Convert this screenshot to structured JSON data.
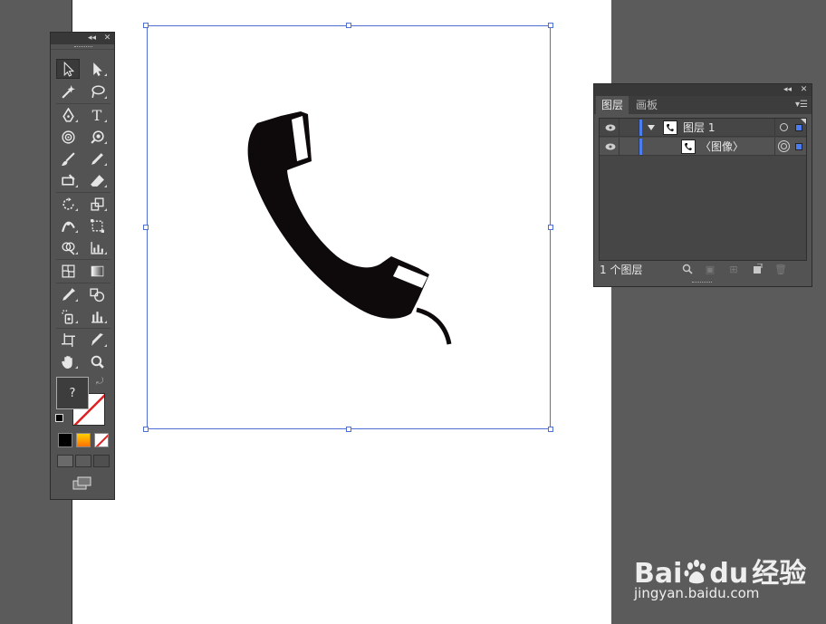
{
  "layers_panel": {
    "tabs": [
      {
        "label": "图层",
        "active": true
      },
      {
        "label": "画板",
        "active": false
      }
    ],
    "rows": [
      {
        "name": "图层 1",
        "expanded": true
      },
      {
        "name": "〈图像〉"
      }
    ],
    "footer_count": "1 个图层",
    "layer_color": "#4b7cf0"
  },
  "tools_panel": {
    "stroke_fill_unknown": "?",
    "tools": [
      "selection-tool",
      "direct-selection-tool",
      "magic-wand-tool",
      "lasso-tool",
      "pen-tool",
      "type-tool",
      "spiral-tool",
      "blob-tool",
      "paintbrush-tool",
      "pencil-tool",
      "eraser-tool",
      "eraser-tool-2",
      "rotate-tool",
      "scale-tool",
      "width-tool",
      "free-transform-tool",
      "shape-builder-tool",
      "graph-tool",
      "mesh-tool",
      "gradient-tool",
      "eyedropper-tool",
      "blend-tool",
      "symbol-sprayer-tool",
      "column-graph-tool",
      "artboard-tool",
      "slice-tool",
      "hand-tool",
      "zoom-tool"
    ]
  },
  "artwork": {
    "icon": "telephone-handset-icon",
    "fill": "#0e0a0b",
    "selection_color": "#4f6fd6"
  },
  "watermark": {
    "brand": "Bai",
    "brand_suffix": "du",
    "service": "经验",
    "url": "jingyan.baidu.com"
  }
}
